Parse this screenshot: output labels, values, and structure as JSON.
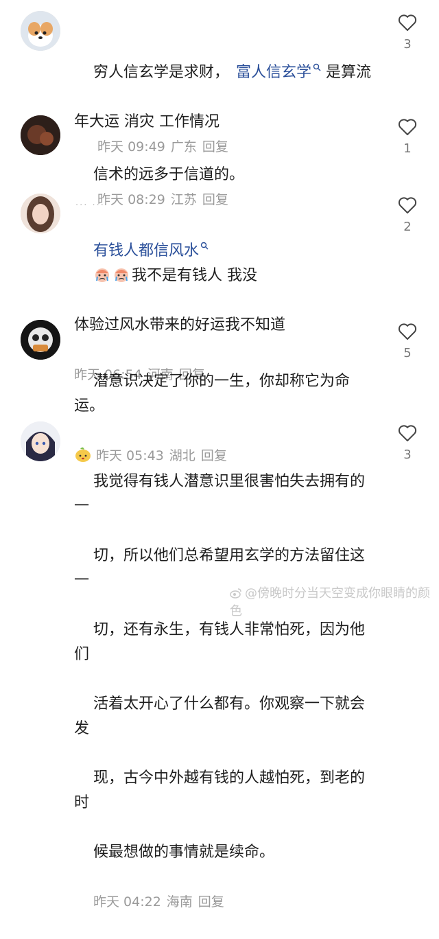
{
  "comments": [
    {
      "text_plain": "穷人信玄学是求财，",
      "text_link": "富人信玄学",
      "text_after": " 是算流",
      "line2": "年大运 消灾 工作情况",
      "time": "昨天 09:49",
      "location": "广东",
      "reply": "回复",
      "likes": "3"
    },
    {
      "text": "信术的远多于信道的。",
      "time": "昨天 08:29",
      "location": "江苏",
      "reply": "回复",
      "likes": "1"
    },
    {
      "username": "··· ···",
      "text_link": "有钱人都信风水",
      "text_after": "我不是有钱人 我没",
      "line2": "体验过风水带来的好运我不知道",
      "time": "昨天 06:54",
      "location": "河南",
      "reply": "回复",
      "likes": "2"
    },
    {
      "text": "潜意识决定了你的一生，你却称它为命运。",
      "time": "昨天 05:43",
      "location": "湖北",
      "reply": "回复",
      "likes": "5"
    },
    {
      "lines": [
        "我觉得有钱人潜意识里很害怕失去拥有的一",
        "切，所以他们总希望用玄学的方法留住这一",
        "切，还有永生，有钱人非常怕死，因为他们",
        "活着太开心了什么都有。你观察一下就会发",
        "现，古今中外越有钱的人越怕死，到老的时",
        "候最想做的事情就是续命。"
      ],
      "time": "昨天 04:22",
      "location": "海南",
      "reply": "回复",
      "likes": "3"
    }
  ],
  "watermark": "@傍晚时分当天空变成你眼睛的颜色",
  "icons": {
    "like": "heart-outline-icon",
    "search": "search-icon",
    "emoji": "crying-face-emoji-icon"
  }
}
